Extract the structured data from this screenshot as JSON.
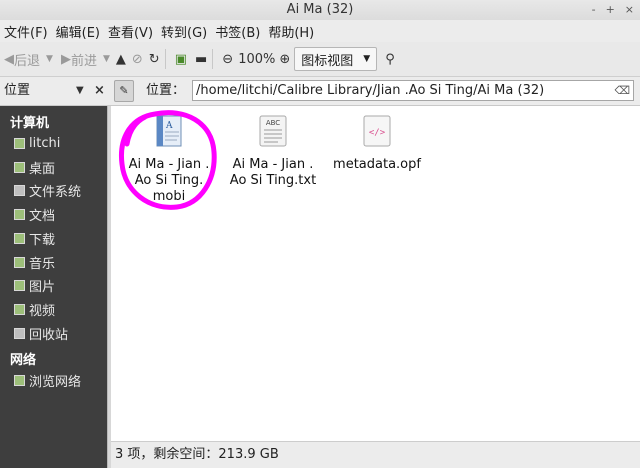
{
  "window": {
    "title": "Ai Ma (32)",
    "controls": [
      "-",
      "+",
      "×"
    ]
  },
  "menu": [
    "文件(F)",
    "编辑(E)",
    "查看(V)",
    "转到(G)",
    "书签(B)",
    "帮助(H)"
  ],
  "toolbar": {
    "back": "后退",
    "forward": "前进",
    "zoom": "100%",
    "view_mode": "图标视图"
  },
  "location": {
    "sidebar_title": "位置",
    "label": "位置：",
    "path": "/home/litchi/Calibre Library/Jian .Ao Si Ting/Ai Ma (32)"
  },
  "sidebar": {
    "computer_heading": "计算机",
    "computer_items": [
      "litchi",
      "桌面",
      "文件系统",
      "文档",
      "下载",
      "音乐",
      "图片",
      "视频",
      "回收站"
    ],
    "network_heading": "网络",
    "network_items": [
      "浏览网络"
    ]
  },
  "files": [
    {
      "name": "Ai Ma - Jian .\nAo Si Ting.\nmobi",
      "icon": "ebook-icon"
    },
    {
      "name": "Ai Ma - Jian .\nAo Si Ting.txt",
      "icon": "text-file-icon",
      "icon_text": "ABC"
    },
    {
      "name": "metadata.opf",
      "icon": "xml-file-icon",
      "icon_text": "</>"
    }
  ],
  "status": "3 项，剩余空间：213.9 GB",
  "colors": {
    "highlight_ring": "#ff00ff",
    "sidebar_bg": "#3e3e3e"
  }
}
